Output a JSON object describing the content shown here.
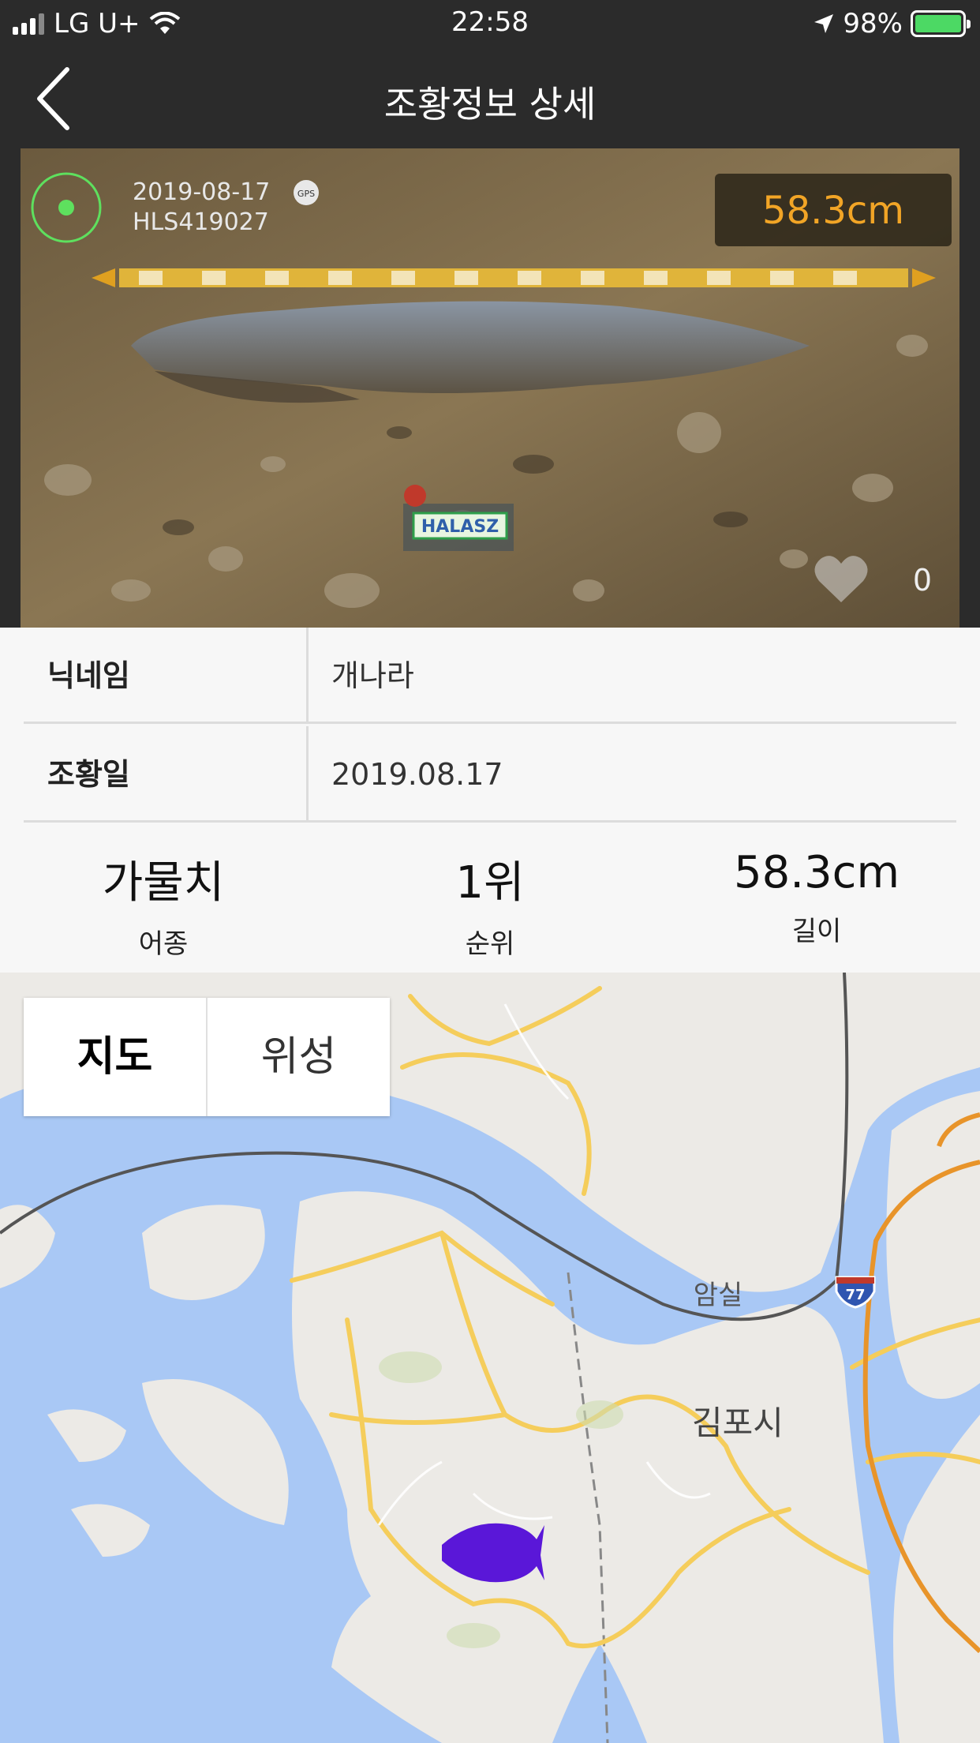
{
  "status_bar": {
    "carrier": "LG U+",
    "time": "22:58",
    "battery": "98%",
    "battery_level": 0.98
  },
  "nav": {
    "title": "조황정보 상세",
    "back_icon": "chevron-left-icon"
  },
  "photo": {
    "date_stamp": "2019-08-17",
    "gps_badge": "GPS",
    "device_id": "HLS419027",
    "measurement": "58.3cm",
    "logo_text": "HALASZ",
    "like_count": "0",
    "like_icon": "heart-icon"
  },
  "info": {
    "rows": [
      {
        "label": "닉네임",
        "value": "개나라"
      },
      {
        "label": "조황일",
        "value": "2019.08.17"
      }
    ],
    "stats": [
      {
        "value": "가물치",
        "label": "어종"
      },
      {
        "value": "1위",
        "label": "순위"
      },
      {
        "value": "58.3cm",
        "label": "길이"
      }
    ]
  },
  "map": {
    "toggle": {
      "map_label": "지도",
      "satellite_label": "위성",
      "selected": "지도"
    },
    "places": {
      "amsil": "암실",
      "gimpo": "김포시",
      "route": "77"
    },
    "marker_icon": "fish-icon",
    "colors": {
      "water": "#a9c8f5",
      "land": "#eceae6",
      "road": "#f5cd5b",
      "marker": "#5a17d8"
    }
  }
}
